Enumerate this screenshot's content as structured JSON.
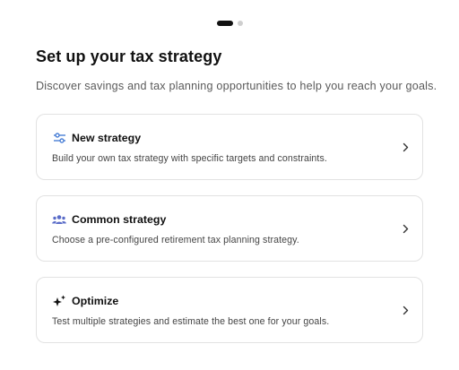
{
  "pager": {
    "total": 2,
    "current": 1
  },
  "header": {
    "title": "Set up your tax strategy",
    "subtitle": "Discover savings and tax planning opportunities to help you reach your goals."
  },
  "options": [
    {
      "icon": "sliders-icon",
      "title": "New strategy",
      "description": "Build your own tax strategy with specific targets and constraints."
    },
    {
      "icon": "users-group-icon",
      "title": "Common strategy",
      "description": "Choose a pre-configured retirement tax planning strategy."
    },
    {
      "icon": "sparkle-icon",
      "title": "Optimize",
      "description": "Test multiple strategies and estimate the best one for your goals."
    }
  ],
  "colors": {
    "sliders_icon": "#4a7fd6",
    "users_icon": "#5a6cc8",
    "sparkle_icon": "#111111",
    "card_border": "#e2e2e2"
  }
}
